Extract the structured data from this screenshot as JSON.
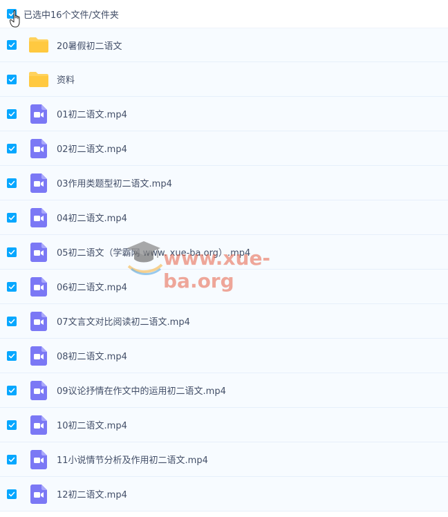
{
  "header": {
    "selection_label": "已选中16个文件/文件夹"
  },
  "colors": {
    "accent": "#06a7ff",
    "folder": "#ffd25c",
    "video": "#7b78f5",
    "row_bg": "#f7fbff",
    "text": "#424e67"
  },
  "watermark": {
    "text": "www.xue-ba.org"
  },
  "files": [
    {
      "name": "20暑假初二语文",
      "type": "folder-icon",
      "checked": true
    },
    {
      "name": "资料",
      "type": "folder-icon",
      "checked": true
    },
    {
      "name": "01初二语文.mp4",
      "type": "video-file-icon",
      "checked": true
    },
    {
      "name": "02初二语文.mp4",
      "type": "video-file-icon",
      "checked": true
    },
    {
      "name": "03作用类题型初二语文.mp4",
      "type": "video-file-icon",
      "checked": true
    },
    {
      "name": "04初二语文.mp4",
      "type": "video-file-icon",
      "checked": true
    },
    {
      "name": "05初二语文（学霸网 www. xue-ba.org）.mp4",
      "type": "video-file-icon",
      "checked": true
    },
    {
      "name": "06初二语文.mp4",
      "type": "video-file-icon",
      "checked": true
    },
    {
      "name": "07文言文对比阅读初二语文.mp4",
      "type": "video-file-icon",
      "checked": true
    },
    {
      "name": "08初二语文.mp4",
      "type": "video-file-icon",
      "checked": true
    },
    {
      "name": "09议论抒情在作文中的运用初二语文.mp4",
      "type": "video-file-icon",
      "checked": true
    },
    {
      "name": "10初二语文.mp4",
      "type": "video-file-icon",
      "checked": true
    },
    {
      "name": "11小说情节分析及作用初二语文.mp4",
      "type": "video-file-icon",
      "checked": true
    },
    {
      "name": "12初二语文.mp4",
      "type": "video-file-icon",
      "checked": true
    }
  ]
}
